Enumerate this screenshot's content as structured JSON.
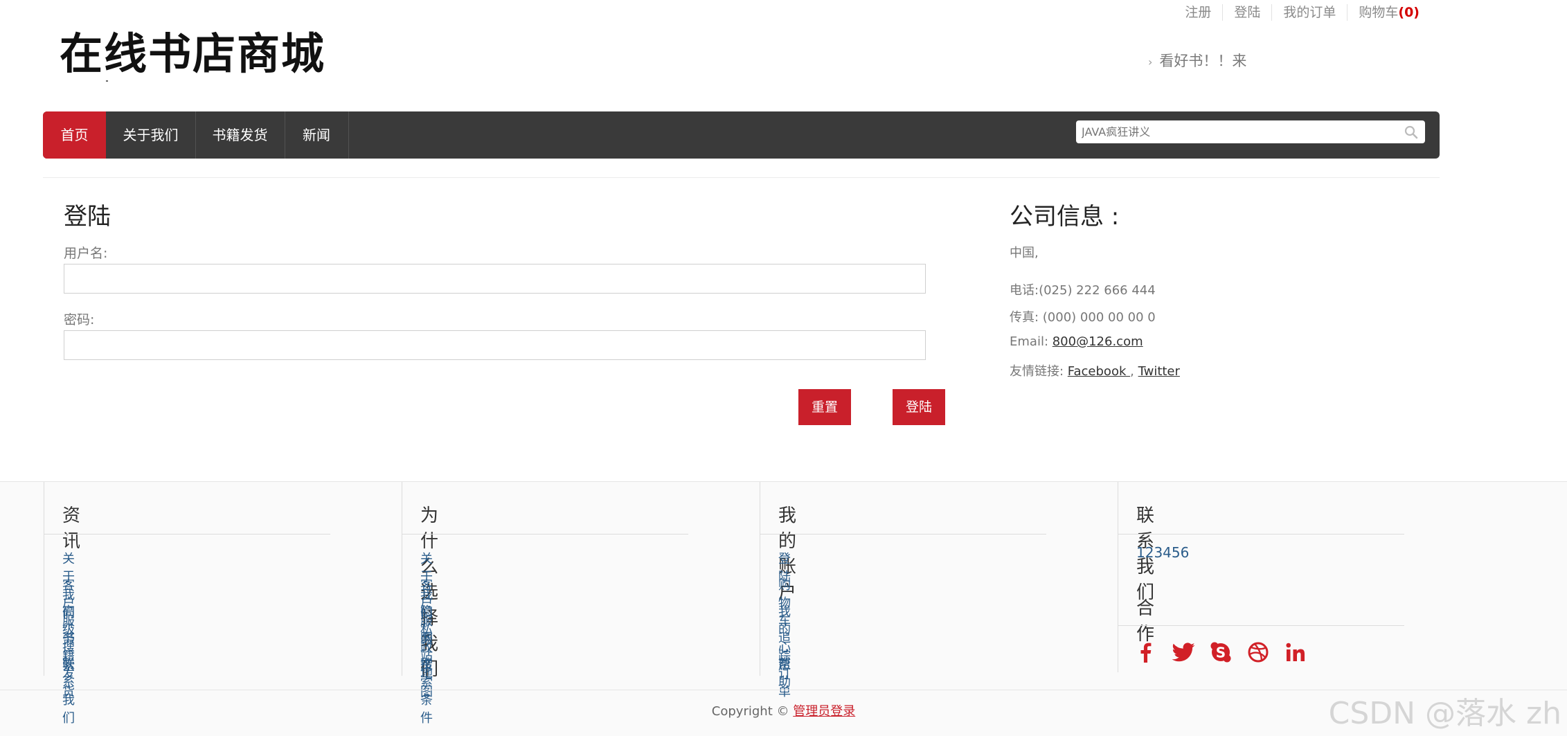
{
  "toplinks": {
    "register": "注册",
    "login": "登陆",
    "orders": "我的订单",
    "cart": "购物车",
    "cart_count": "(0)"
  },
  "logo": {
    "text": "在线书店商城"
  },
  "tagline": {
    "arrow": "›",
    "text": "看好书！！来"
  },
  "nav": {
    "items": [
      "首页",
      "关于我们",
      "书籍发货",
      "新闻"
    ],
    "active_index": 0,
    "search_placeholder": "JAVA疯狂讲义"
  },
  "login": {
    "title": "登陆",
    "username_label": "用户名:",
    "password_label": "密码:",
    "reset_button": "重置",
    "submit_button": "登陆"
  },
  "company": {
    "title": "公司信息 :",
    "country": "中国,",
    "phone": "电话:(025) 222 666 444",
    "fax": "传真: (000) 000 00 00 0",
    "email_label": "Email: ",
    "email": "800@126.com",
    "links_label": "友情链接: ",
    "link_facebook": "Facebook ",
    "link_sep": ",",
    "link_twitter": "Twitter"
  },
  "footer": {
    "col1": {
      "title": "资讯",
      "links": [
        "关于我们",
        "客户服务",
        "高级搜索",
        "书籍发货",
        "联系我们"
      ]
    },
    "col2": {
      "title": "为什么选择我们",
      "links": [
        "关于我们",
        "客户服务",
        "隐私政策",
        "网站地图",
        "搜索条件"
      ]
    },
    "col3": {
      "title": "我的账户",
      "links": [
        "登陆",
        "购物车",
        "我的心愿",
        "追踪订单",
        "帮助"
      ]
    },
    "col4": {
      "title": "联系我们",
      "value": "123456",
      "coop_title": "合作"
    },
    "social_icons": [
      "facebook-icon",
      "twitter-icon",
      "skype-icon",
      "dribbble-icon",
      "linkedin-icon"
    ],
    "copyright": "Copyright © ",
    "admin_link": "管理员登录"
  },
  "watermark": "CSDN @落水 zh",
  "colors": {
    "accent": "#c9202b",
    "nav_bg": "#3a3a3a",
    "link": "#2a5c8a"
  }
}
